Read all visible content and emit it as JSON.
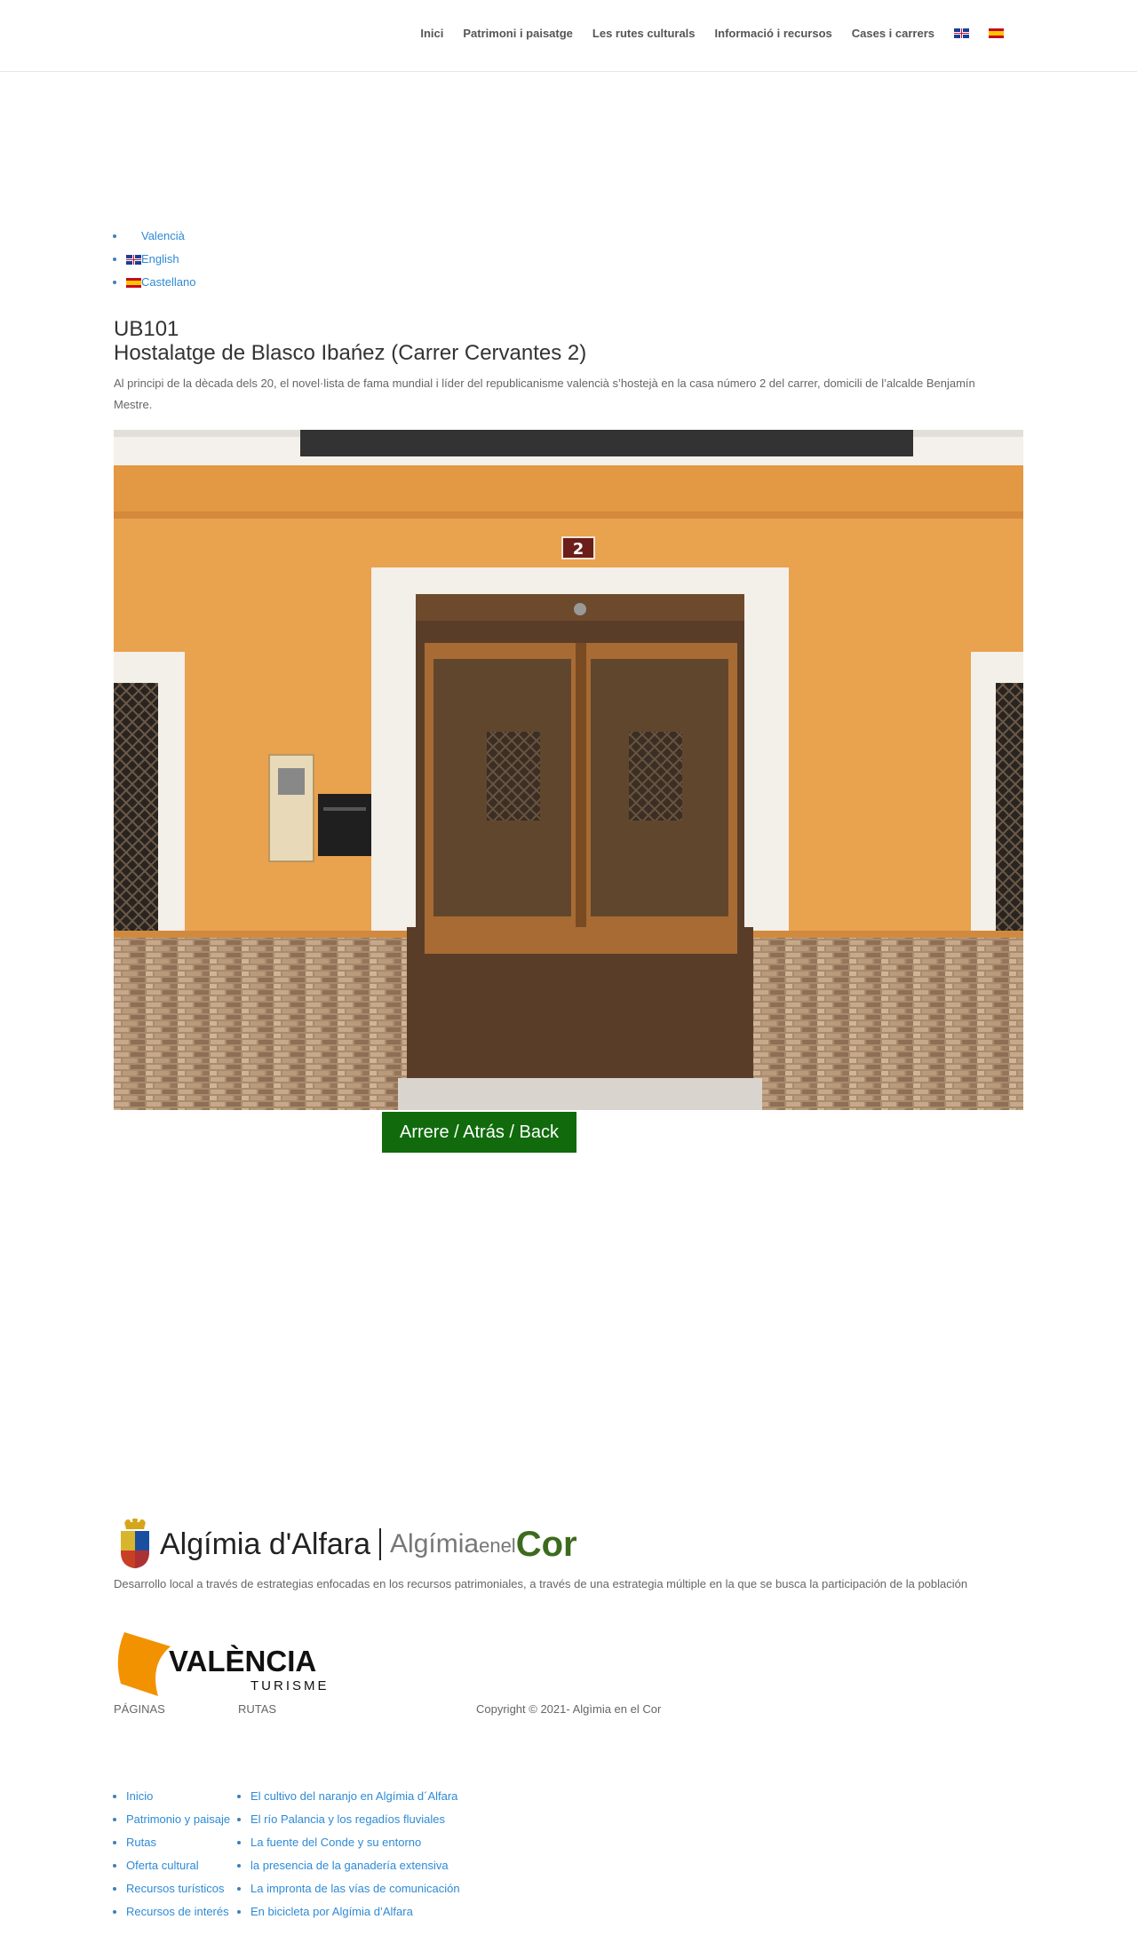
{
  "nav": {
    "items": [
      "Inici",
      "Patrimoni i paisatge",
      "Les rutes culturals",
      "Informació i recursos",
      "Cases i carrers"
    ],
    "flags": [
      "uk-flag-icon",
      "spain-flag-icon"
    ]
  },
  "languages": [
    {
      "label": "Valencià",
      "icon": "valencia-flag-icon"
    },
    {
      "label": "English",
      "icon": "uk-flag-icon"
    },
    {
      "label": "Castellano",
      "icon": "spain-flag-icon"
    }
  ],
  "content": {
    "code": "UB101",
    "title": "Hostalatge de Blasco Ibańez (Carrer Cervantes 2)",
    "description": "Al principi de la dècada dels 20, el novel·lista de fama mundial i líder del republicanisme valencià s’hostejà en la casa número 2 del carrer, domicili de l’alcalde Benjamín Mestre.",
    "house_number": "2",
    "back_button": "Arrere / Atrás / Back"
  },
  "footer": {
    "brand_main": "Algímia d'Alfara",
    "brand_sub_a": "Algímia",
    "brand_sub_b": "enel",
    "brand_sub_c": "Cor",
    "description": "Desarrollo local a través de estrategias enfocadas en los recursos patrimoniales, a través de  una estrategia múltiple en la que se busca la participación de la población",
    "vt_title": "VALÈNCIA",
    "vt_sub": "TURISME",
    "pages_heading": "PÁGINAS",
    "routes_heading": "RUTAS",
    "copyright": "Copyright © 2021- Algìmia en el Cor",
    "pages": [
      "Inicio",
      "Patrimonio y paisaje",
      "Rutas",
      "Oferta cultural",
      "Recursos turísticos",
      "Recursos de interés"
    ],
    "routes": [
      "El cultivo del naranjo en Algímia d´Alfara",
      "El río Palancia y los regadíos fluviales",
      "La fuente del Conde y su entorno",
      "la presencia de la ganadería extensiva",
      "La impronta de las vías de comunicación",
      "En bicicleta por Algímia d’Alfara"
    ]
  },
  "colors": {
    "link": "#2e8ad6",
    "button": "#116b0d",
    "brand_green": "#3d6b1e",
    "vt_orange": "#f39200"
  }
}
